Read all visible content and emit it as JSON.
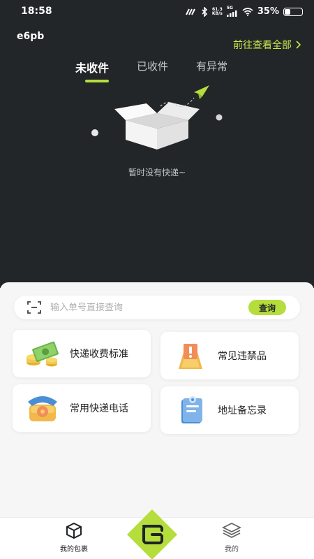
{
  "status_bar": {
    "time": "18:58",
    "net_speed_value": "61.3",
    "net_speed_unit": "KB/s",
    "network": "5G",
    "battery_text": "35%",
    "battery_level": 0.35
  },
  "header": {
    "user_id": "e6pb",
    "view_all_label": "前往查看全部"
  },
  "tabs": [
    {
      "label": "未收件",
      "active": true
    },
    {
      "label": "已收件",
      "active": false
    },
    {
      "label": "有异常",
      "active": false
    }
  ],
  "empty_state": {
    "message": "暂时没有快递~"
  },
  "search": {
    "placeholder": "输入单号直接查询",
    "button_label": "查询"
  },
  "cards": [
    {
      "label": "快递收费标准",
      "icon": "money-stack-icon"
    },
    {
      "label": "常见违禁品",
      "icon": "warning-sign-icon"
    },
    {
      "label": "常用快递电话",
      "icon": "telephone-icon"
    },
    {
      "label": "地址备忘录",
      "icon": "memo-book-icon"
    }
  ],
  "bottom_nav": {
    "left_label": "我的包裹",
    "right_label": "我的",
    "accent": "#b5dd3c"
  },
  "colors": {
    "dark_bg": "#222628",
    "accent": "#b5dd3c",
    "accent_text": "#c7e84b"
  }
}
